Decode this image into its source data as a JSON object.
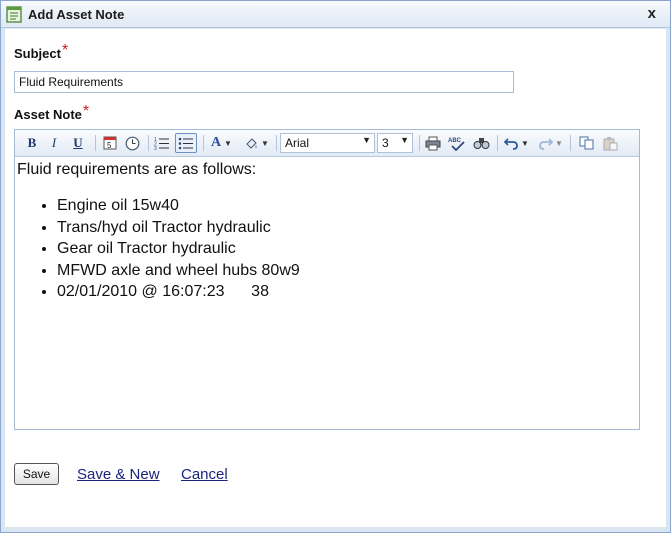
{
  "window": {
    "title": "Add Asset Note",
    "close_glyph": "x"
  },
  "form": {
    "subject_label": "Subject",
    "subject_value": "Fluid Requirements",
    "note_label": "Asset Note",
    "required_mark": "*"
  },
  "toolbar": {
    "bold": "B",
    "italic": "I",
    "underline": "U",
    "font_color": "A",
    "font_family": "Arial",
    "font_size": "3",
    "icons": [
      "bold-icon",
      "italic-icon",
      "underline-icon",
      "insert-date-icon",
      "insert-time-icon",
      "ordered-list-icon",
      "unordered-list-icon",
      "font-color-icon",
      "highlight-color-icon",
      "print-icon",
      "spellcheck-icon",
      "find-icon",
      "undo-icon",
      "redo-icon",
      "copy-icon",
      "paste-icon"
    ]
  },
  "note": {
    "intro": "Fluid requirements are as follows:",
    "items": [
      "Engine oil 15w40",
      "Trans/hyd oil Tractor hydraulic",
      "Gear oil Tractor hydraulic",
      "MFWD axle and wheel hubs 80w9",
      "02/01/2010 @ 16:07:23      38"
    ]
  },
  "actions": {
    "save": "Save",
    "save_new": "Save & New",
    "cancel": "Cancel"
  },
  "colors": {
    "accent": "#1a237e",
    "required": "#cc1f1f",
    "titlebar": "#dfe8f4"
  }
}
